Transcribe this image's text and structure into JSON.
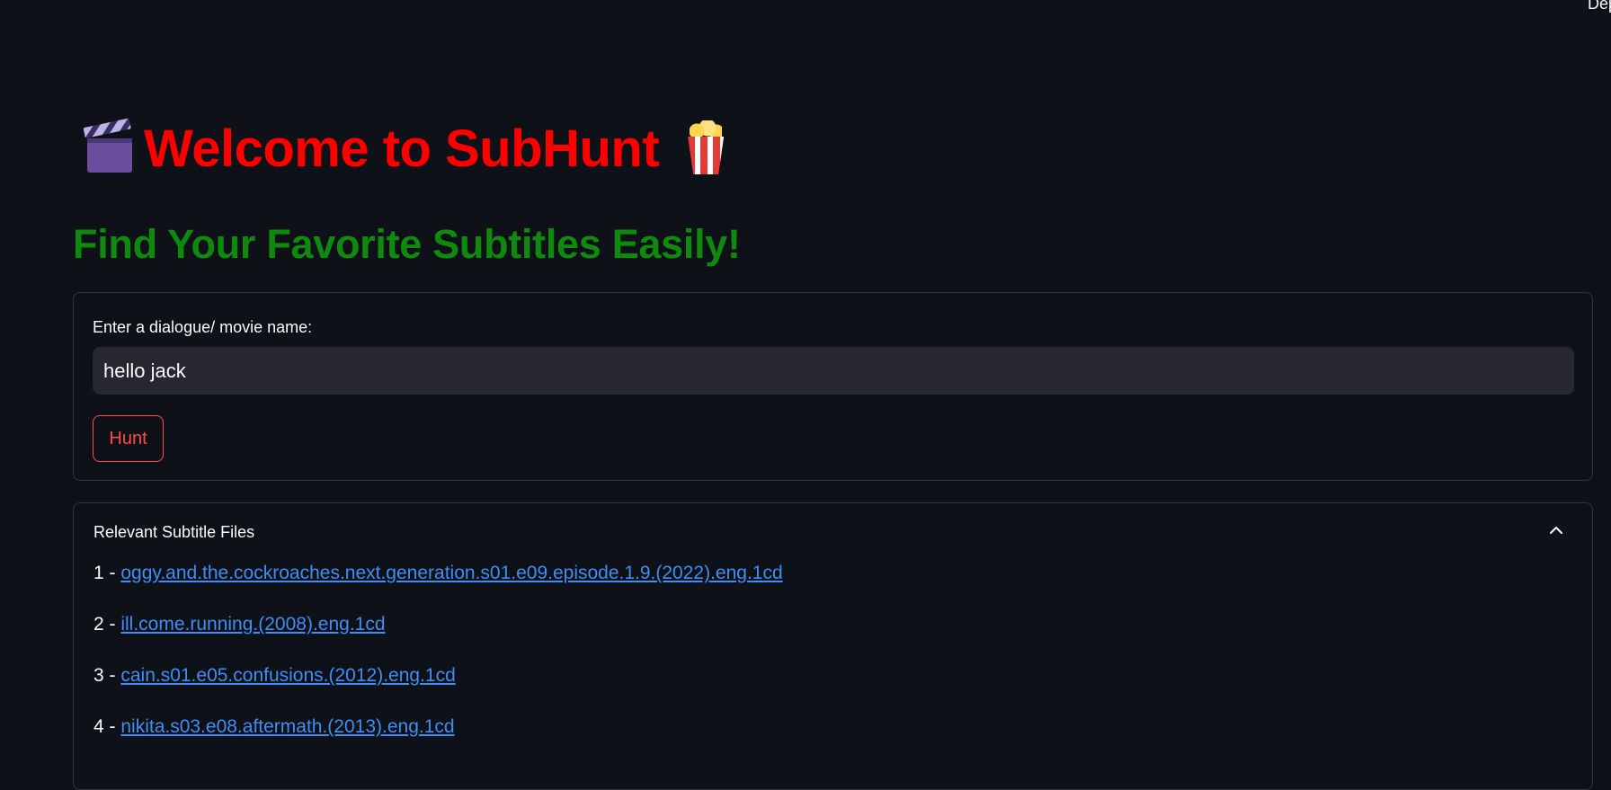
{
  "top_right": {
    "text": "Dep"
  },
  "header": {
    "title": "Welcome to SubHunt",
    "clapper_icon": "clapperboard-icon",
    "popcorn_icon": "popcorn-icon",
    "title_color": "#ff0000"
  },
  "subtitle": {
    "text": "Find Your Favorite Subtitles Easily!",
    "color": "#0f8a0f"
  },
  "search_form": {
    "label": "Enter a dialogue/ movie name:",
    "input_value": "hello jack",
    "button_label": "Hunt"
  },
  "results": {
    "title": "Relevant Subtitle Files",
    "expanded": true,
    "toggle_icon": "chevron-up-icon",
    "items": [
      {
        "index": "1 - ",
        "name": "oggy.and.the.cockroaches.next.generation.s01.e09.episode.1.9.(2022).eng.1cd"
      },
      {
        "index": "2 - ",
        "name": "ill.come.running.(2008).eng.1cd"
      },
      {
        "index": "3 - ",
        "name": "cain.s01.e05.confusions.(2012).eng.1cd"
      },
      {
        "index": "4 - ",
        "name": "nikita.s03.e08.aftermath.(2013).eng.1cd"
      }
    ]
  },
  "colors": {
    "background": "#0e1117",
    "accent": "#ff4b4b",
    "link": "#3f8ef5"
  }
}
